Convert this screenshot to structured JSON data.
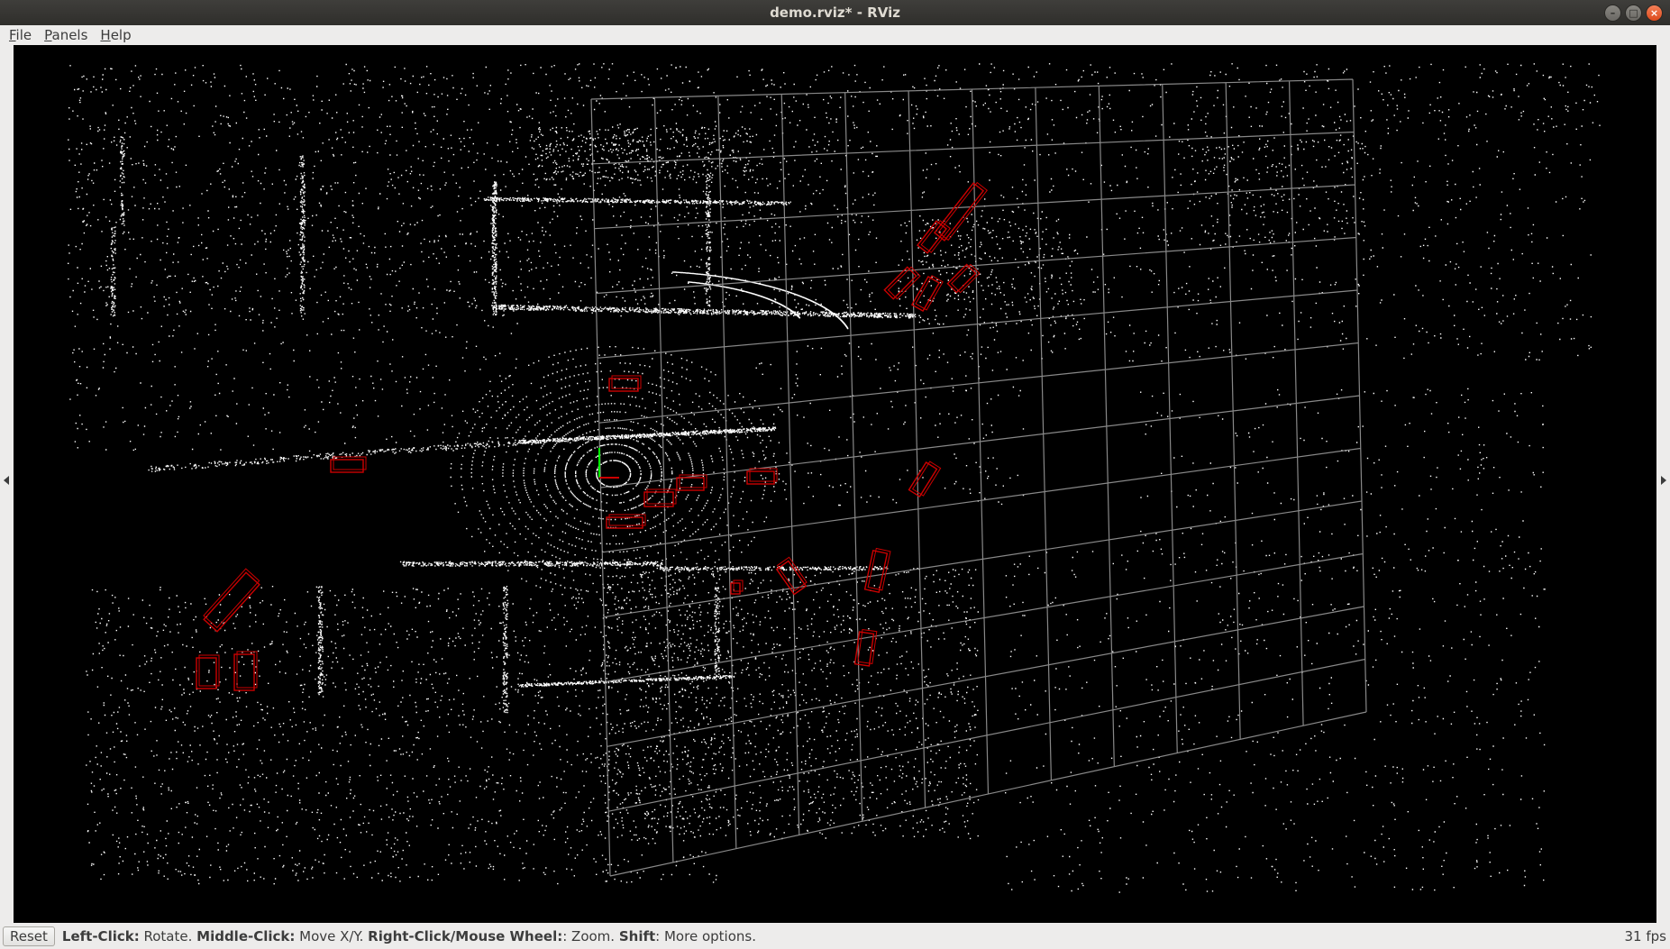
{
  "window": {
    "title": "demo.rviz* - RViz",
    "buttons": [
      "minimize-icon",
      "maximize-icon",
      "close-icon"
    ]
  },
  "menu": {
    "file": {
      "accel": "F",
      "rest": "ile"
    },
    "panels": {
      "accel": "P",
      "rest": "anels"
    },
    "help": {
      "accel": "H",
      "rest": "elp"
    }
  },
  "viewport": {
    "background": "#000000",
    "grid_color": "#a0a0a0",
    "point_color": "#ffffff",
    "bbox_color": "#cc0000",
    "axis_color": "#00ff00"
  },
  "status": {
    "reset_label": "Reset",
    "hints": [
      {
        "key": "Left-Click:",
        "action": " Rotate. "
      },
      {
        "key": "Middle-Click:",
        "action": " Move X/Y. "
      },
      {
        "key": "Right-Click/Mouse Wheel:",
        "action": ": Zoom. "
      },
      {
        "key": "Shift",
        "action": ": More options."
      }
    ],
    "fps": "31 fps"
  }
}
